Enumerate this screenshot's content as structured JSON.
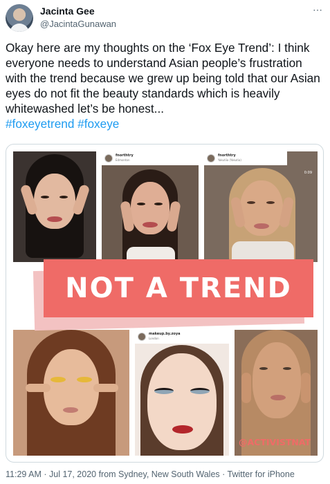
{
  "author": {
    "name": "Jacinta Gee",
    "handle": "@JacintaGunawan"
  },
  "more_icon": "⋯",
  "tweet": {
    "text": "Okay here are my thoughts on the ‘Fox Eye Trend’: I think everyone needs to understand Asian people’s frustration with the trend because we grew up being told that our Asian eyes do not fit the beauty standards which is heavily whitewashed let’s be honest...",
    "hashtags": [
      "#foxeyetrend",
      "#foxeye"
    ]
  },
  "media": {
    "banner_text": "NOT A TREND",
    "watermark": "@ACTIVISTNAT",
    "ig_posts": [
      {
        "user": "fnorthtry",
        "sub": "Edmonton"
      },
      {
        "user": "fnorthtry",
        "sub": "Yakutiia (Yakutia)"
      },
      {
        "user": "makeup.by.zoya",
        "sub": "London"
      }
    ],
    "video_time": "0:09"
  },
  "footer": "11:29 AM · Jul 17, 2020 from Sydney, New South Wales · Twitter for iPhone",
  "colors": {
    "link": "#1d9bf0",
    "banner": "#ef6b67",
    "secondary_text": "#536471"
  }
}
